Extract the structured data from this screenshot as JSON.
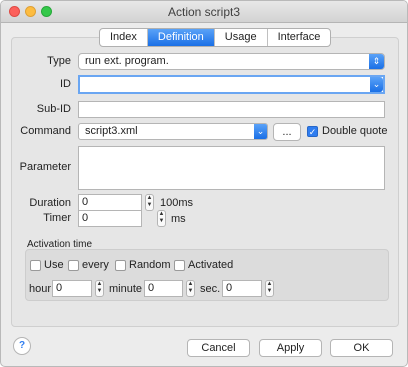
{
  "window": {
    "title": "Action script3"
  },
  "tabs": [
    "Index",
    "Definition",
    "Usage",
    "Interface"
  ],
  "active_tab": "Definition",
  "form": {
    "type_label": "Type",
    "type_value": "run ext. program.",
    "id_label": "ID",
    "id_value": "",
    "subid_label": "Sub-ID",
    "subid_value": "",
    "command_label": "Command",
    "command_value": "script3.xml",
    "browse_label": "...",
    "double_quote_label": "Double quote",
    "double_quote_checked": true,
    "parameter_label": "Parameter",
    "parameter_value": "",
    "duration_label": "Duration",
    "duration_value": "0",
    "duration_unit": "100ms",
    "timer_label": "Timer",
    "timer_value": "0",
    "timer_unit": "ms"
  },
  "activation": {
    "title": "Activation time",
    "use_label": "Use",
    "every_label": "every",
    "random_label": "Random",
    "activated_label": "Activated",
    "hour_label": "hour",
    "hour_value": "0",
    "minute_label": "minute",
    "minute_value": "0",
    "sec_label": "sec.",
    "sec_value": "0"
  },
  "buttons": {
    "help": "?",
    "cancel": "Cancel",
    "apply": "Apply",
    "ok": "OK"
  },
  "colors": {
    "accent": "#1a6fe6",
    "focus": "#6aa6f2"
  }
}
